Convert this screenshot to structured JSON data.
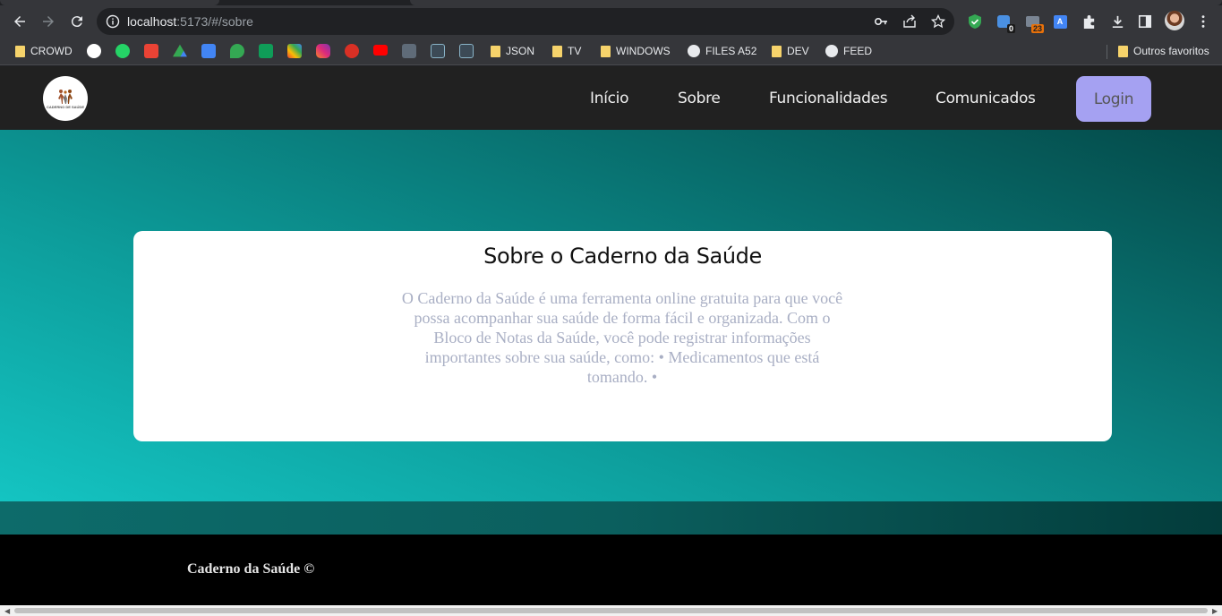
{
  "browser": {
    "url_host": "localhost",
    "url_rest": ":5173/#/sobre",
    "extension_badges": {
      "ext2": "0",
      "ext3": "23"
    }
  },
  "bookmarks": {
    "items": [
      {
        "label": "CROWD",
        "type": "folder"
      },
      {
        "label": "JSON",
        "type": "folder"
      },
      {
        "label": "TV",
        "type": "folder"
      },
      {
        "label": "WINDOWS",
        "type": "folder"
      },
      {
        "label": "FILES A52",
        "type": "globe"
      },
      {
        "label": "DEV",
        "type": "folder"
      },
      {
        "label": "FEED",
        "type": "globe"
      }
    ],
    "other": "Outros favoritos"
  },
  "site": {
    "logo_text": "CADERNO DE SAÚDE",
    "nav": [
      "Início",
      "Sobre",
      "Funcionalidades",
      "Comunicados"
    ],
    "login_label": "Login",
    "card_title": "Sobre o Caderno da Saúde",
    "card_text": "O Caderno da Saúde é uma ferramenta online gratuita para que você possa acompanhar sua saúde de forma fácil e organizada. Com o Bloco de Notas da Saúde, você pode registrar informações importantes sobre sua saúde, como: • Medicamentos que está tomando. •",
    "footer": "Caderno da Saúde ©"
  },
  "colors": {
    "navbar": "#212121",
    "login_button": "#a5a1f2",
    "hero_light": "#14c4c2",
    "hero_dark": "#044a49"
  }
}
